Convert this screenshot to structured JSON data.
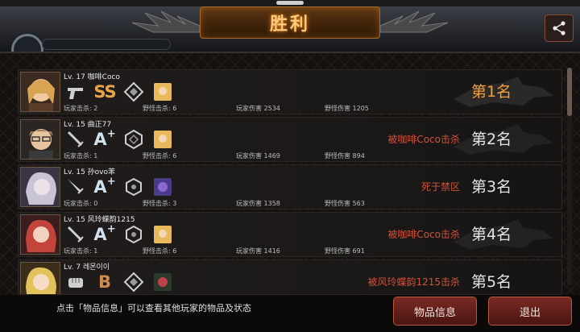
{
  "banner": {
    "title": "胜利"
  },
  "footer": {
    "hint": "点击「物品信息」可以查看其他玩家的物品及状态",
    "item_info_button": "物品信息",
    "exit_button": "退出"
  },
  "players": [
    {
      "level_name": "Lv. 17 咖啡Coco",
      "weapon_icon": "pistol-icon",
      "grade": "SS",
      "player_kills": "玩家击杀: 2",
      "monster_kills": "野怪击杀: 6",
      "player_damage": "玩家伤害 2534",
      "monster_damage": "野怪伤害 1205",
      "killed_by": "",
      "rank": "第1名",
      "avatar_color": "#d9a354"
    },
    {
      "level_name": "Lv. 15 曲正77",
      "weapon_icon": "sword-icon",
      "grade": "A",
      "grade_sup": "+",
      "player_kills": "玩家击杀: 1",
      "monster_kills": "野怪击杀: 6",
      "player_damage": "玩家伤害 1469",
      "monster_damage": "野怪伤害 894",
      "killed_by": "被咖啡Coco击杀",
      "rank": "第2名",
      "avatar_color": "#9b7a58"
    },
    {
      "level_name": "Lv. 15 孙ovo苯",
      "weapon_icon": "dagger-icon",
      "grade": "A",
      "grade_sup": "+",
      "player_kills": "玩家击杀: 0",
      "monster_kills": "野怪击杀: 3",
      "player_damage": "玩家伤害 1358",
      "monster_damage": "野怪伤害 563",
      "killed_by": "死于禁区",
      "rank": "第3名",
      "avatar_color": "#c9c3d6"
    },
    {
      "level_name": "Lv. 15 风玲蝶韵1215",
      "weapon_icon": "sword-icon",
      "grade": "A",
      "grade_sup": "+",
      "player_kills": "玩家击杀: 1",
      "monster_kills": "野怪击杀: 6",
      "player_damage": "玩家伤害 1416",
      "monster_damage": "野怪伤害 691",
      "killed_by": "被咖啡Coco击杀",
      "rank": "第4名",
      "avatar_color": "#c2443a"
    },
    {
      "level_name": "Lv. 7 레몬이이",
      "weapon_icon": "fist-icon",
      "grade": "B",
      "player_kills": "",
      "monster_kills": "",
      "player_damage": "",
      "monster_damage": "",
      "killed_by": "被风玲蝶韵1215击杀",
      "rank": "第5名",
      "avatar_color": "#e3c25e"
    }
  ]
}
